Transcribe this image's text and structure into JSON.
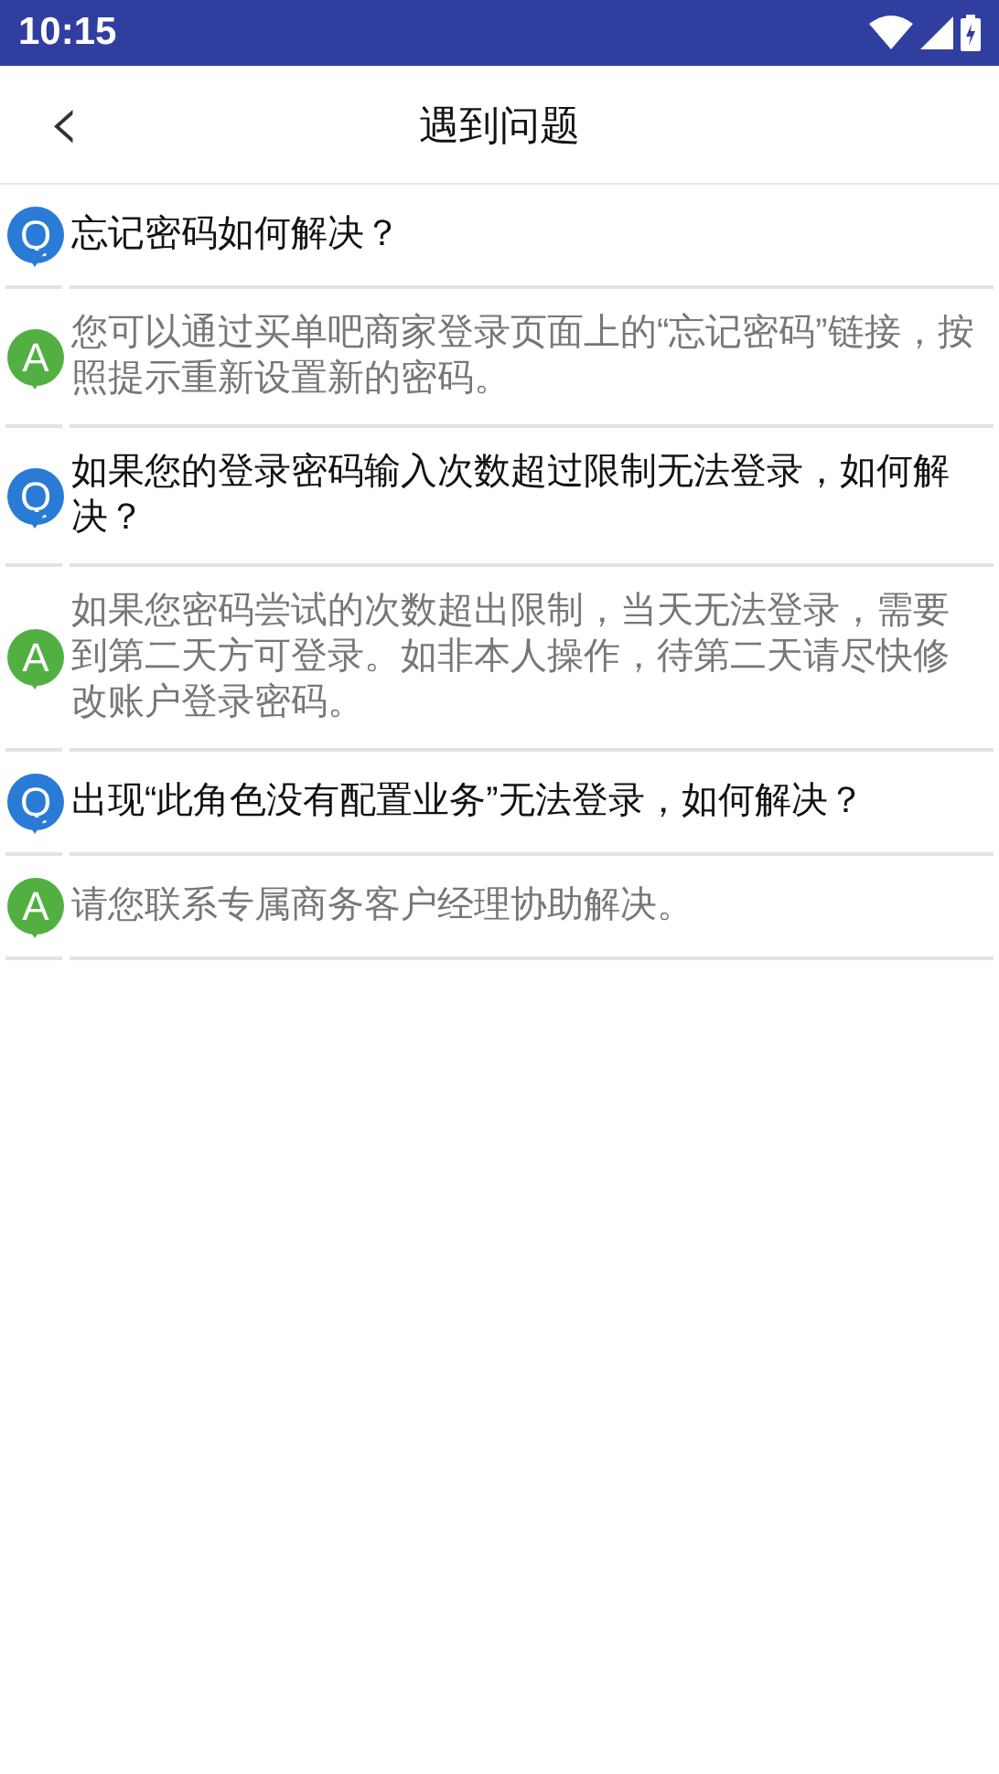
{
  "status_bar": {
    "time": "10:15"
  },
  "header": {
    "back": "‹",
    "title": "遇到问题"
  },
  "items": [
    {
      "kind": "question",
      "badge": "Q",
      "text": "忘记密码如何解决？"
    },
    {
      "kind": "answer",
      "badge": "A",
      "text": "您可以通过买单吧商家登录页面上的“忘记密码”链接，按照提示重新设置新的密码。"
    },
    {
      "kind": "question",
      "badge": "Q",
      "text": "如果您的登录密码输入次数超过限制无法登录，如何解决？"
    },
    {
      "kind": "answer",
      "badge": "A",
      "text": "如果您密码尝试的次数超出限制，当天无法登录，需要到第二天方可登录。如非本人操作，待第二天请尽快修改账户登录密码。"
    },
    {
      "kind": "question",
      "badge": "Q",
      "text": "出现“此角色没有配置业务”无法登录，如何解决？"
    },
    {
      "kind": "answer",
      "badge": "A",
      "text": "请您联系专属商务客户经理协助解决。"
    }
  ]
}
